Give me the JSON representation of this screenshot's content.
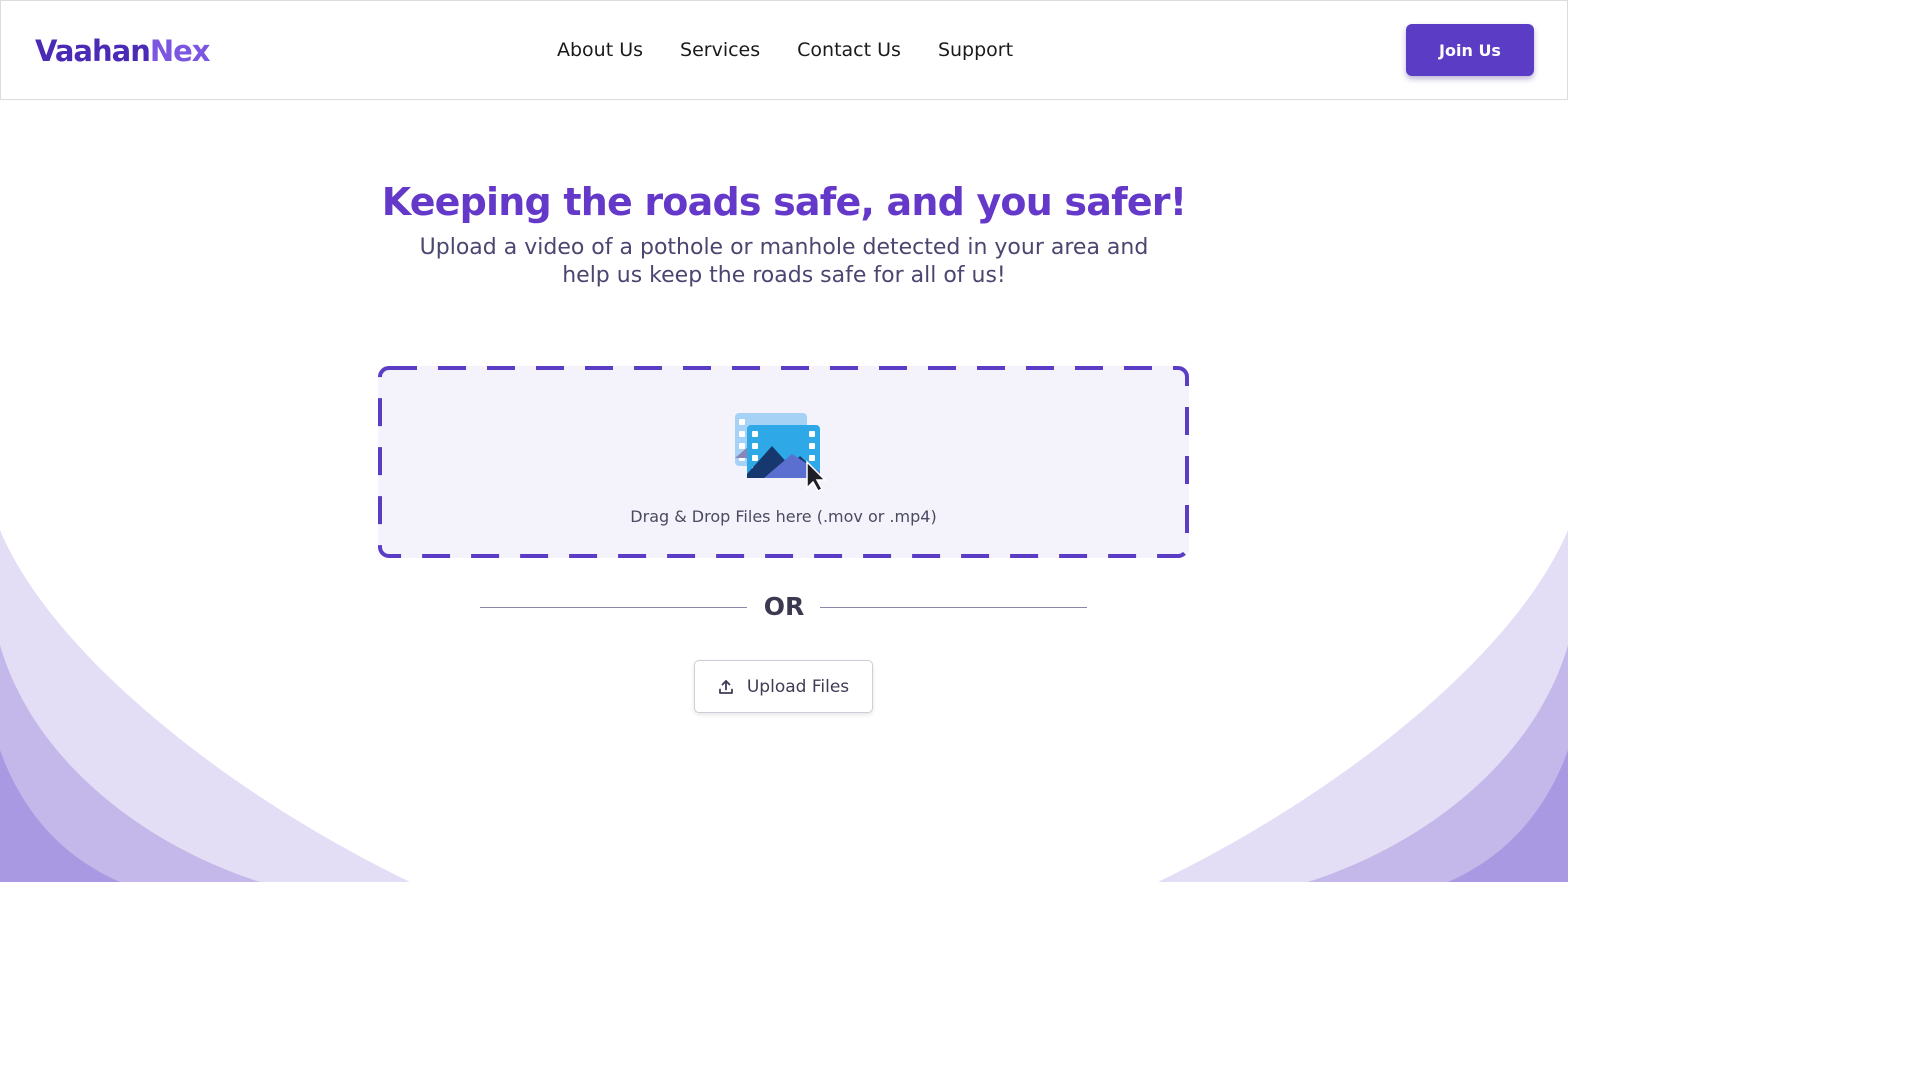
{
  "header": {
    "logo": {
      "part1": "Vaahan",
      "part2": "Nex"
    },
    "nav": [
      "About Us",
      "Services",
      "Contact Us",
      "Support"
    ],
    "join_label": "Join Us"
  },
  "hero": {
    "title": "Keeping the roads safe, and you safer!",
    "subtitle": "Upload a video of a pothole or manhole detected in your area and help us keep the roads safe for all of us!"
  },
  "dropzone": {
    "icon": "video-file-icon",
    "text": "Drag & Drop Files here (.mov or .mp4)"
  },
  "divider": {
    "text": "OR"
  },
  "upload": {
    "icon": "upload-icon",
    "label": "Upload Files"
  },
  "colors": {
    "brand": "#5b3cc4",
    "title": "#6439c9",
    "wave_light": "#e3def5",
    "wave_mid": "#c4b8ea",
    "wave_dark": "#a999e2"
  }
}
